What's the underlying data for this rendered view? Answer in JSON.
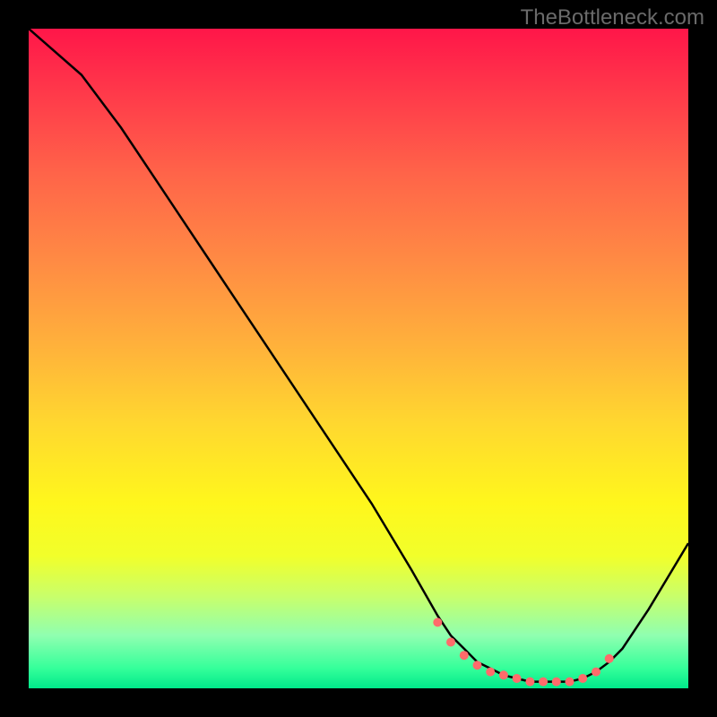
{
  "watermark": "TheBottleneck.com",
  "chart_data": {
    "type": "line",
    "title": "",
    "xlabel": "",
    "ylabel": "",
    "xlim": [
      0,
      100
    ],
    "ylim": [
      0,
      100
    ],
    "grid": false,
    "series": [
      {
        "name": "curve",
        "x": [
          0,
          8,
          14,
          20,
          28,
          36,
          44,
          52,
          58,
          62,
          64,
          66,
          68,
          70,
          72,
          74,
          76,
          78,
          80,
          82,
          84,
          86,
          88,
          90,
          94,
          100
        ],
        "values": [
          100,
          93,
          85,
          76,
          64,
          52,
          40,
          28,
          18,
          11,
          8,
          6,
          4,
          3,
          2,
          1.5,
          1,
          1,
          1,
          1,
          1.5,
          2.5,
          4,
          6,
          12,
          22
        ],
        "color": "#000000"
      }
    ],
    "dots": {
      "x": [
        62,
        64,
        66,
        68,
        70,
        72,
        74,
        76,
        78,
        80,
        82,
        84,
        86,
        88
      ],
      "values": [
        10,
        7,
        5,
        3.5,
        2.5,
        2,
        1.5,
        1,
        1,
        1,
        1,
        1.5,
        2.5,
        4.5
      ],
      "color": "#ff6b6b",
      "radius": 5
    },
    "gradient_stops": [
      {
        "pos": 0,
        "color": "#ff1649"
      },
      {
        "pos": 22,
        "color": "#ff6449"
      },
      {
        "pos": 48,
        "color": "#ffb13b"
      },
      {
        "pos": 72,
        "color": "#fff71c"
      },
      {
        "pos": 92,
        "color": "#8fffb0"
      },
      {
        "pos": 100,
        "color": "#00e98a"
      }
    ]
  }
}
